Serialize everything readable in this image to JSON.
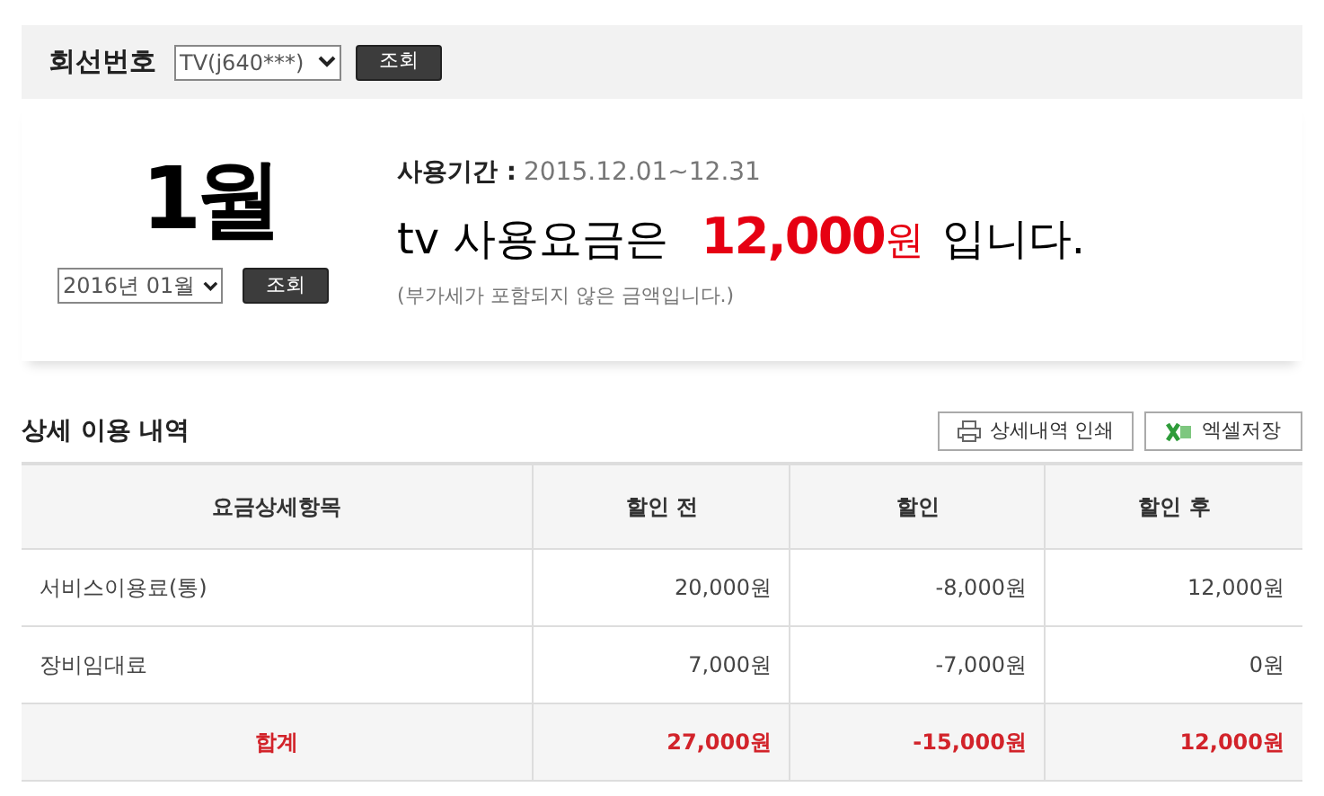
{
  "line_selector": {
    "label": "회선번호",
    "value": "TV(j640***)",
    "button": "조회"
  },
  "month_summary": {
    "month": "1월",
    "month_select": "2016년 01월",
    "button": "조회",
    "period_label": "사용기간 :",
    "period": "2015.12.01~12.31",
    "charge_prefix": "tv 사용요금은",
    "charge_amount": "12,000",
    "charge_unit": "원",
    "charge_suffix": "입니다.",
    "note": "(부가세가 포함되지 않은 금액입니다.)"
  },
  "details": {
    "title": "상세 이용 내역",
    "buttons": [
      {
        "kind": "print",
        "label": "상세내역 인쇄"
      },
      {
        "kind": "excel",
        "label": "엑셀저장"
      }
    ],
    "table": {
      "columns": [
        "요금상세항목",
        "할인 전",
        "할인",
        "할인 후"
      ],
      "rows": [
        {
          "kind": "item",
          "cells": [
            "서비스이용료(통)",
            "20,000원",
            "-8,000원",
            "12,000원"
          ]
        },
        {
          "kind": "item",
          "cells": [
            "장비임대료",
            "7,000원",
            "-7,000원",
            "0원"
          ]
        },
        {
          "kind": "total",
          "cells": [
            "합계",
            "27,000원",
            "-15,000원",
            "12,000원"
          ]
        }
      ]
    }
  }
}
